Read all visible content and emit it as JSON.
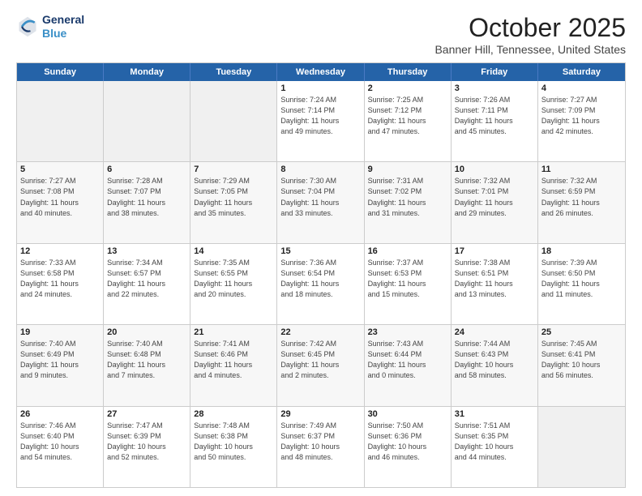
{
  "header": {
    "logo_line1": "General",
    "logo_line2": "Blue",
    "month": "October 2025",
    "location": "Banner Hill, Tennessee, United States"
  },
  "days_of_week": [
    "Sunday",
    "Monday",
    "Tuesday",
    "Wednesday",
    "Thursday",
    "Friday",
    "Saturday"
  ],
  "weeks": [
    [
      {
        "day": "",
        "info": ""
      },
      {
        "day": "",
        "info": ""
      },
      {
        "day": "",
        "info": ""
      },
      {
        "day": "1",
        "info": "Sunrise: 7:24 AM\nSunset: 7:14 PM\nDaylight: 11 hours\nand 49 minutes."
      },
      {
        "day": "2",
        "info": "Sunrise: 7:25 AM\nSunset: 7:12 PM\nDaylight: 11 hours\nand 47 minutes."
      },
      {
        "day": "3",
        "info": "Sunrise: 7:26 AM\nSunset: 7:11 PM\nDaylight: 11 hours\nand 45 minutes."
      },
      {
        "day": "4",
        "info": "Sunrise: 7:27 AM\nSunset: 7:09 PM\nDaylight: 11 hours\nand 42 minutes."
      }
    ],
    [
      {
        "day": "5",
        "info": "Sunrise: 7:27 AM\nSunset: 7:08 PM\nDaylight: 11 hours\nand 40 minutes."
      },
      {
        "day": "6",
        "info": "Sunrise: 7:28 AM\nSunset: 7:07 PM\nDaylight: 11 hours\nand 38 minutes."
      },
      {
        "day": "7",
        "info": "Sunrise: 7:29 AM\nSunset: 7:05 PM\nDaylight: 11 hours\nand 35 minutes."
      },
      {
        "day": "8",
        "info": "Sunrise: 7:30 AM\nSunset: 7:04 PM\nDaylight: 11 hours\nand 33 minutes."
      },
      {
        "day": "9",
        "info": "Sunrise: 7:31 AM\nSunset: 7:02 PM\nDaylight: 11 hours\nand 31 minutes."
      },
      {
        "day": "10",
        "info": "Sunrise: 7:32 AM\nSunset: 7:01 PM\nDaylight: 11 hours\nand 29 minutes."
      },
      {
        "day": "11",
        "info": "Sunrise: 7:32 AM\nSunset: 6:59 PM\nDaylight: 11 hours\nand 26 minutes."
      }
    ],
    [
      {
        "day": "12",
        "info": "Sunrise: 7:33 AM\nSunset: 6:58 PM\nDaylight: 11 hours\nand 24 minutes."
      },
      {
        "day": "13",
        "info": "Sunrise: 7:34 AM\nSunset: 6:57 PM\nDaylight: 11 hours\nand 22 minutes."
      },
      {
        "day": "14",
        "info": "Sunrise: 7:35 AM\nSunset: 6:55 PM\nDaylight: 11 hours\nand 20 minutes."
      },
      {
        "day": "15",
        "info": "Sunrise: 7:36 AM\nSunset: 6:54 PM\nDaylight: 11 hours\nand 18 minutes."
      },
      {
        "day": "16",
        "info": "Sunrise: 7:37 AM\nSunset: 6:53 PM\nDaylight: 11 hours\nand 15 minutes."
      },
      {
        "day": "17",
        "info": "Sunrise: 7:38 AM\nSunset: 6:51 PM\nDaylight: 11 hours\nand 13 minutes."
      },
      {
        "day": "18",
        "info": "Sunrise: 7:39 AM\nSunset: 6:50 PM\nDaylight: 11 hours\nand 11 minutes."
      }
    ],
    [
      {
        "day": "19",
        "info": "Sunrise: 7:40 AM\nSunset: 6:49 PM\nDaylight: 11 hours\nand 9 minutes."
      },
      {
        "day": "20",
        "info": "Sunrise: 7:40 AM\nSunset: 6:48 PM\nDaylight: 11 hours\nand 7 minutes."
      },
      {
        "day": "21",
        "info": "Sunrise: 7:41 AM\nSunset: 6:46 PM\nDaylight: 11 hours\nand 4 minutes."
      },
      {
        "day": "22",
        "info": "Sunrise: 7:42 AM\nSunset: 6:45 PM\nDaylight: 11 hours\nand 2 minutes."
      },
      {
        "day": "23",
        "info": "Sunrise: 7:43 AM\nSunset: 6:44 PM\nDaylight: 11 hours\nand 0 minutes."
      },
      {
        "day": "24",
        "info": "Sunrise: 7:44 AM\nSunset: 6:43 PM\nDaylight: 10 hours\nand 58 minutes."
      },
      {
        "day": "25",
        "info": "Sunrise: 7:45 AM\nSunset: 6:41 PM\nDaylight: 10 hours\nand 56 minutes."
      }
    ],
    [
      {
        "day": "26",
        "info": "Sunrise: 7:46 AM\nSunset: 6:40 PM\nDaylight: 10 hours\nand 54 minutes."
      },
      {
        "day": "27",
        "info": "Sunrise: 7:47 AM\nSunset: 6:39 PM\nDaylight: 10 hours\nand 52 minutes."
      },
      {
        "day": "28",
        "info": "Sunrise: 7:48 AM\nSunset: 6:38 PM\nDaylight: 10 hours\nand 50 minutes."
      },
      {
        "day": "29",
        "info": "Sunrise: 7:49 AM\nSunset: 6:37 PM\nDaylight: 10 hours\nand 48 minutes."
      },
      {
        "day": "30",
        "info": "Sunrise: 7:50 AM\nSunset: 6:36 PM\nDaylight: 10 hours\nand 46 minutes."
      },
      {
        "day": "31",
        "info": "Sunrise: 7:51 AM\nSunset: 6:35 PM\nDaylight: 10 hours\nand 44 minutes."
      },
      {
        "day": "",
        "info": ""
      }
    ]
  ]
}
